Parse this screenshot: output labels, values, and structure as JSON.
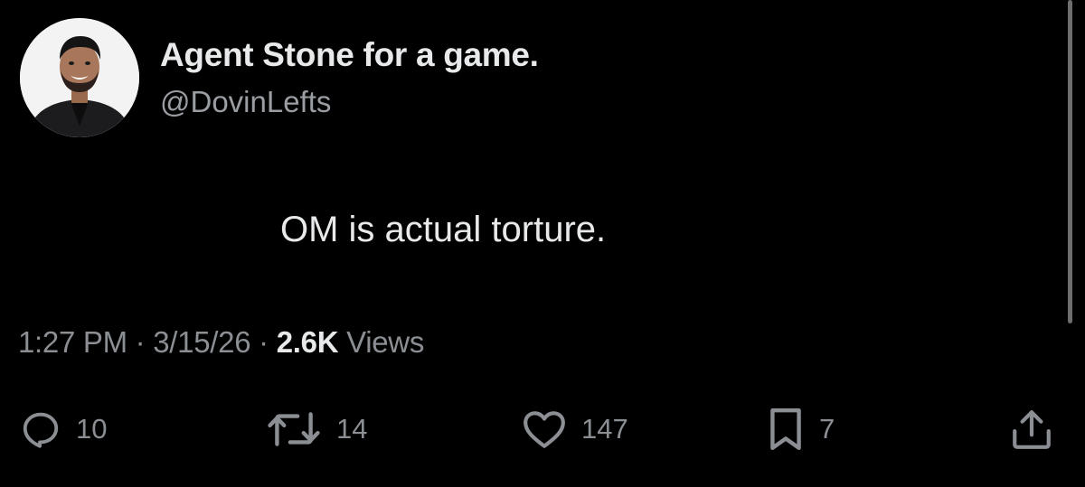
{
  "tweet": {
    "display_name": "Agent Stone for a game.",
    "handle": "@DovinLefts",
    "text": "OM is actual torture.",
    "time": "1:27 PM",
    "separator": "·",
    "date": "3/15/26",
    "views_count": "2.6K",
    "views_label": "Views"
  },
  "actions": {
    "replies": "10",
    "reposts": "14",
    "likes": "147",
    "bookmarks": "7"
  },
  "icons": {
    "reply": "reply-icon",
    "repost": "repost-icon",
    "like": "heart-icon",
    "bookmark": "bookmark-icon",
    "share": "share-icon"
  },
  "colors": {
    "background": "#000000",
    "primary_text": "#e7e9ea",
    "secondary_text": "#8b8f94"
  }
}
